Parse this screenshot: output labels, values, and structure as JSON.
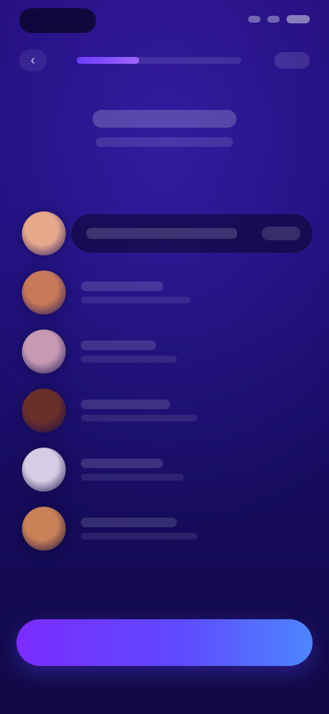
{
  "status_bar": {},
  "header": {
    "progress": 0.38
  },
  "title_block": {},
  "list": {
    "items": [
      {
        "avatar_color": "#e7a98b",
        "highlighted": true
      },
      {
        "avatar_color": "#c7795a",
        "highlighted": false
      },
      {
        "avatar_color": "#c69ab3",
        "highlighted": false
      },
      {
        "avatar_color": "#6b2f2a",
        "highlighted": false
      },
      {
        "avatar_color": "#d6cde4",
        "highlighted": false
      },
      {
        "avatar_color": "#c98158",
        "highlighted": false
      }
    ]
  },
  "cta": {
    "label": ""
  },
  "colors": {
    "background_top": "#2a0f9a",
    "background_bottom": "#170d5b",
    "cta_gradient_start": "#7b2cff",
    "cta_gradient_end": "#4d86ff"
  }
}
